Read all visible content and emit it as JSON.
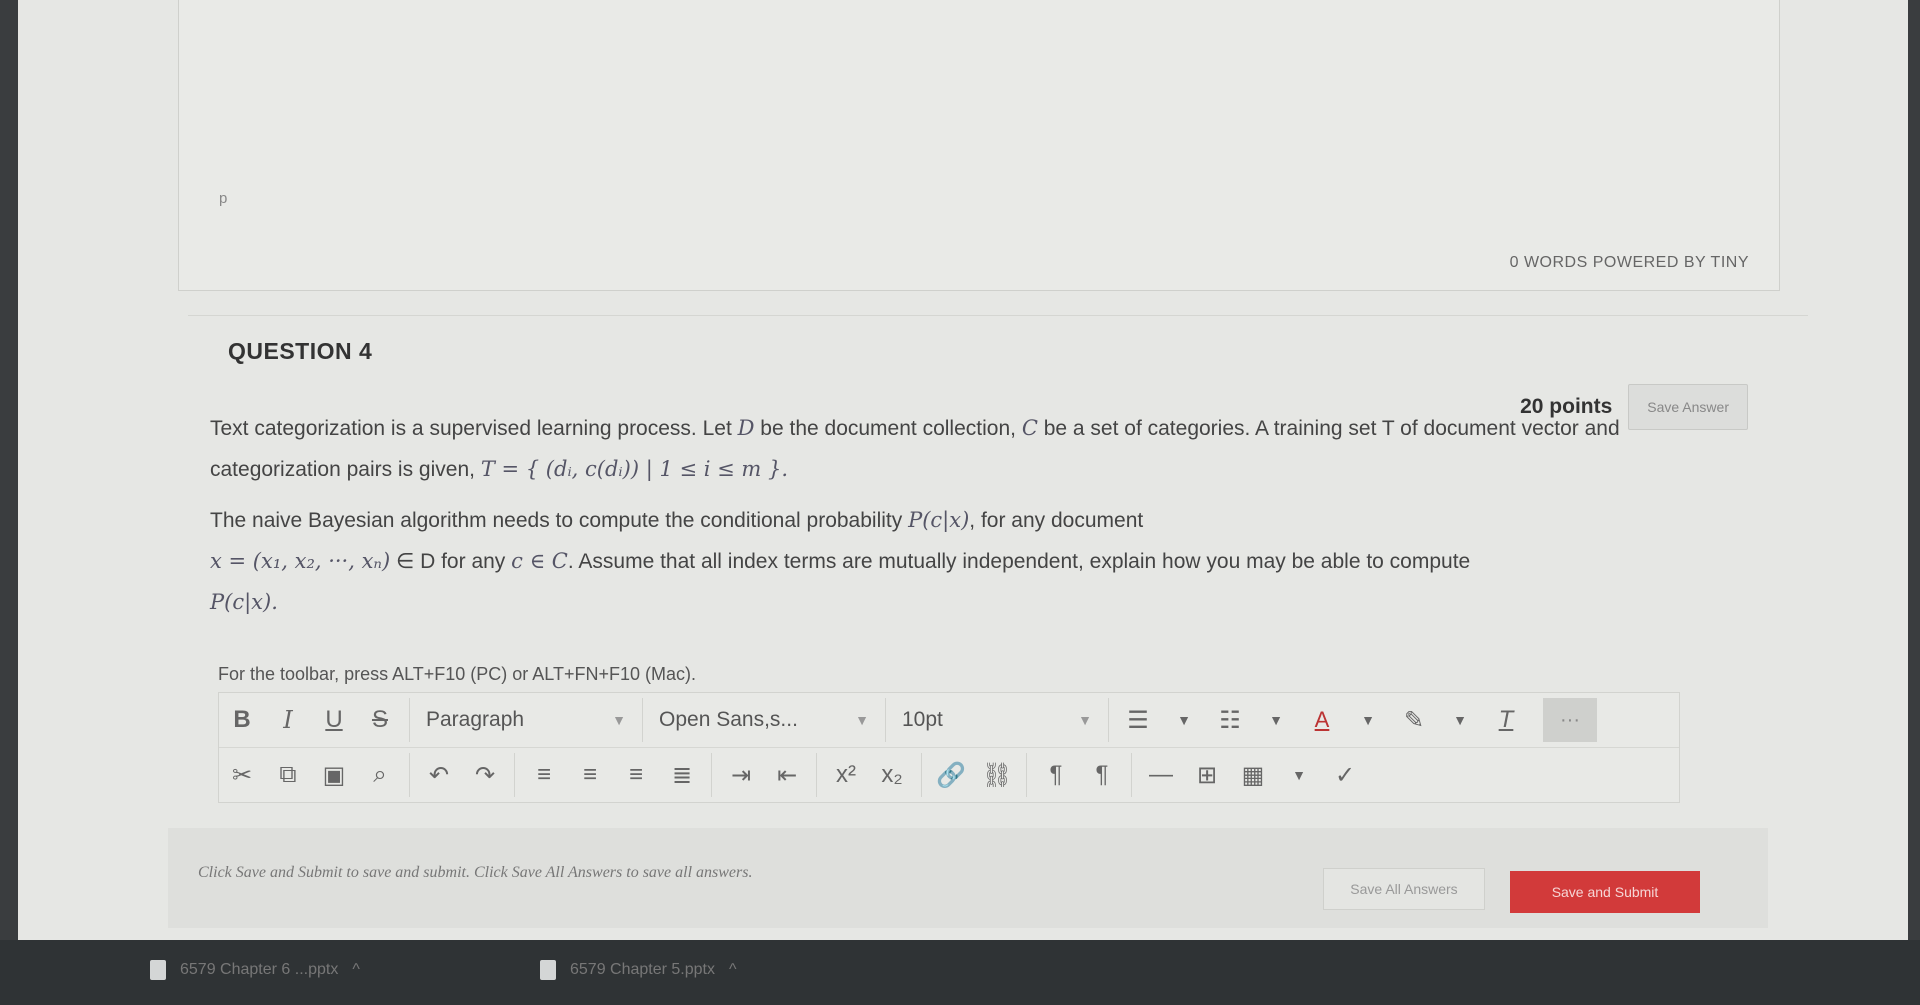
{
  "editor": {
    "paragraph_marker": "p",
    "status": "0 WORDS  POWERED BY TINY"
  },
  "question": {
    "title": "QUESTION 4",
    "points": "20 points",
    "save_answer": "Save Answer",
    "text_line1_a": "Text categorization is a supervised learning process. Let ",
    "var_D": "D",
    "text_line1_b": " be the document collection, ",
    "var_C": "C",
    "text_line1_c": " be a set of categories. A training set T of document vector and categorization pairs is given, ",
    "training_set_formula": "T = { (dᵢ, c(dᵢ)) | 1 ≤ i ≤ m }.",
    "text_line2_a": "The naive Bayesian algorithm needs to compute the conditional probability ",
    "prob_formula": "P(c|x)",
    "text_line2_b": ", for any document",
    "doc_formula": "x = (x₁, x₂, ···, xₙ)",
    "text_line3_a": " ∈ D for any ",
    "cat_formula": "c ∈ C",
    "text_line3_b": ". Assume that all index terms are mutually independent, explain how you may be able to compute",
    "prob_formula_end": "P(c|x)."
  },
  "toolbar": {
    "note": "For the toolbar, press ALT+F10 (PC) or ALT+FN+F10 (Mac).",
    "bold": "B",
    "italic": "I",
    "underline": "U",
    "strike": "S",
    "paragraph": "Paragraph",
    "font": "Open Sans,s...",
    "size": "10pt",
    "more": "···"
  },
  "footer": {
    "note": "Click Save and Submit to save and submit. Click Save All Answers to save all answers.",
    "save_all": "Save All Answers",
    "save_submit": "Save and Submit"
  },
  "taskbar": {
    "download1": "6579 Chapter 6 ...pptx",
    "download2": "6579 Chapter 5.pptx"
  },
  "colors": {
    "submit_red": "#d23a3a",
    "page_bg": "#e6e7e4"
  }
}
